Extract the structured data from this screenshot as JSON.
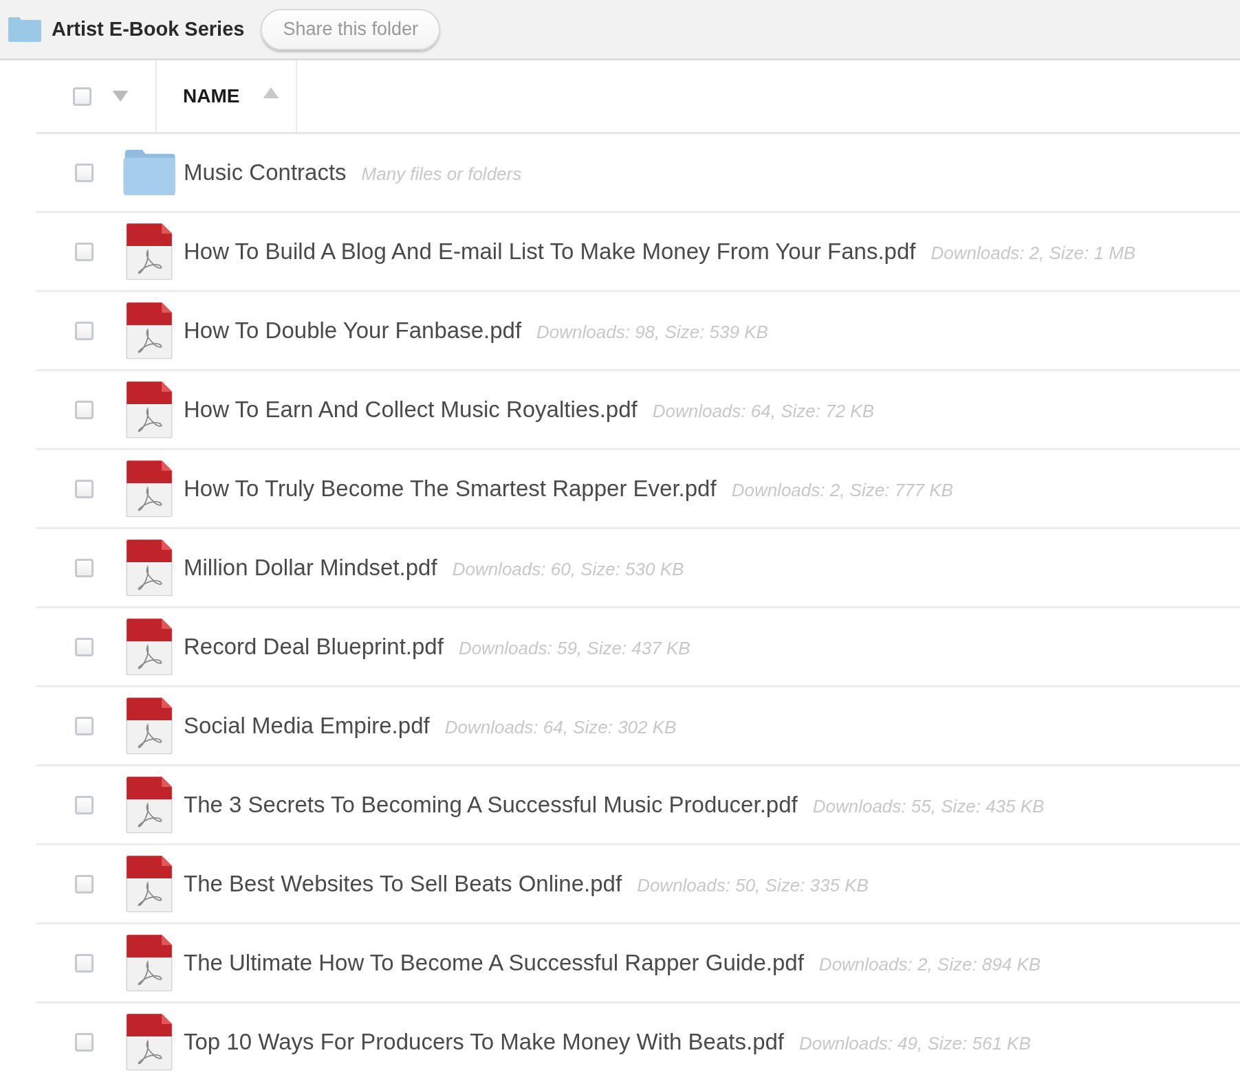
{
  "header": {
    "title": "Artist E-Book Series",
    "share_button": "Share this folder"
  },
  "table": {
    "select_all": {
      "checked": false
    },
    "columns": [
      {
        "label": "NAME"
      }
    ],
    "rows": [
      {
        "kind": "folder",
        "name": "Music Contracts",
        "meta": "Many files or folders",
        "checked": false
      },
      {
        "kind": "pdf",
        "name": "How To Build A Blog And E-mail List To Make Money From Your Fans.pdf",
        "meta": "Downloads: 2, Size: 1 MB",
        "checked": false
      },
      {
        "kind": "pdf",
        "name": "How To Double Your Fanbase.pdf",
        "meta": "Downloads: 98, Size: 539 KB",
        "checked": false
      },
      {
        "kind": "pdf",
        "name": "How To Earn And Collect Music Royalties.pdf",
        "meta": "Downloads: 64, Size: 72 KB",
        "checked": false
      },
      {
        "kind": "pdf",
        "name": "How To Truly Become The Smartest Rapper Ever.pdf",
        "meta": "Downloads: 2, Size: 777 KB",
        "checked": false
      },
      {
        "kind": "pdf",
        "name": "Million Dollar Mindset.pdf",
        "meta": "Downloads: 60, Size: 530 KB",
        "checked": false
      },
      {
        "kind": "pdf",
        "name": "Record Deal Blueprint.pdf",
        "meta": "Downloads: 59, Size: 437 KB",
        "checked": false
      },
      {
        "kind": "pdf",
        "name": "Social Media Empire.pdf",
        "meta": "Downloads: 64, Size: 302 KB",
        "checked": false
      },
      {
        "kind": "pdf",
        "name": "The 3 Secrets To Becoming A Successful Music Producer.pdf",
        "meta": "Downloads: 55, Size: 435 KB",
        "checked": false
      },
      {
        "kind": "pdf",
        "name": "The Best Websites To Sell Beats Online.pdf",
        "meta": "Downloads: 50, Size: 335 KB",
        "checked": false
      },
      {
        "kind": "pdf",
        "name": "The Ultimate How To Become A Successful Rapper Guide.pdf",
        "meta": "Downloads: 2, Size: 894 KB",
        "checked": false
      },
      {
        "kind": "pdf",
        "name": "Top 10 Ways For Producers To Make Money With Beats.pdf",
        "meta": "Downloads: 49, Size: 561 KB",
        "checked": false
      }
    ]
  }
}
